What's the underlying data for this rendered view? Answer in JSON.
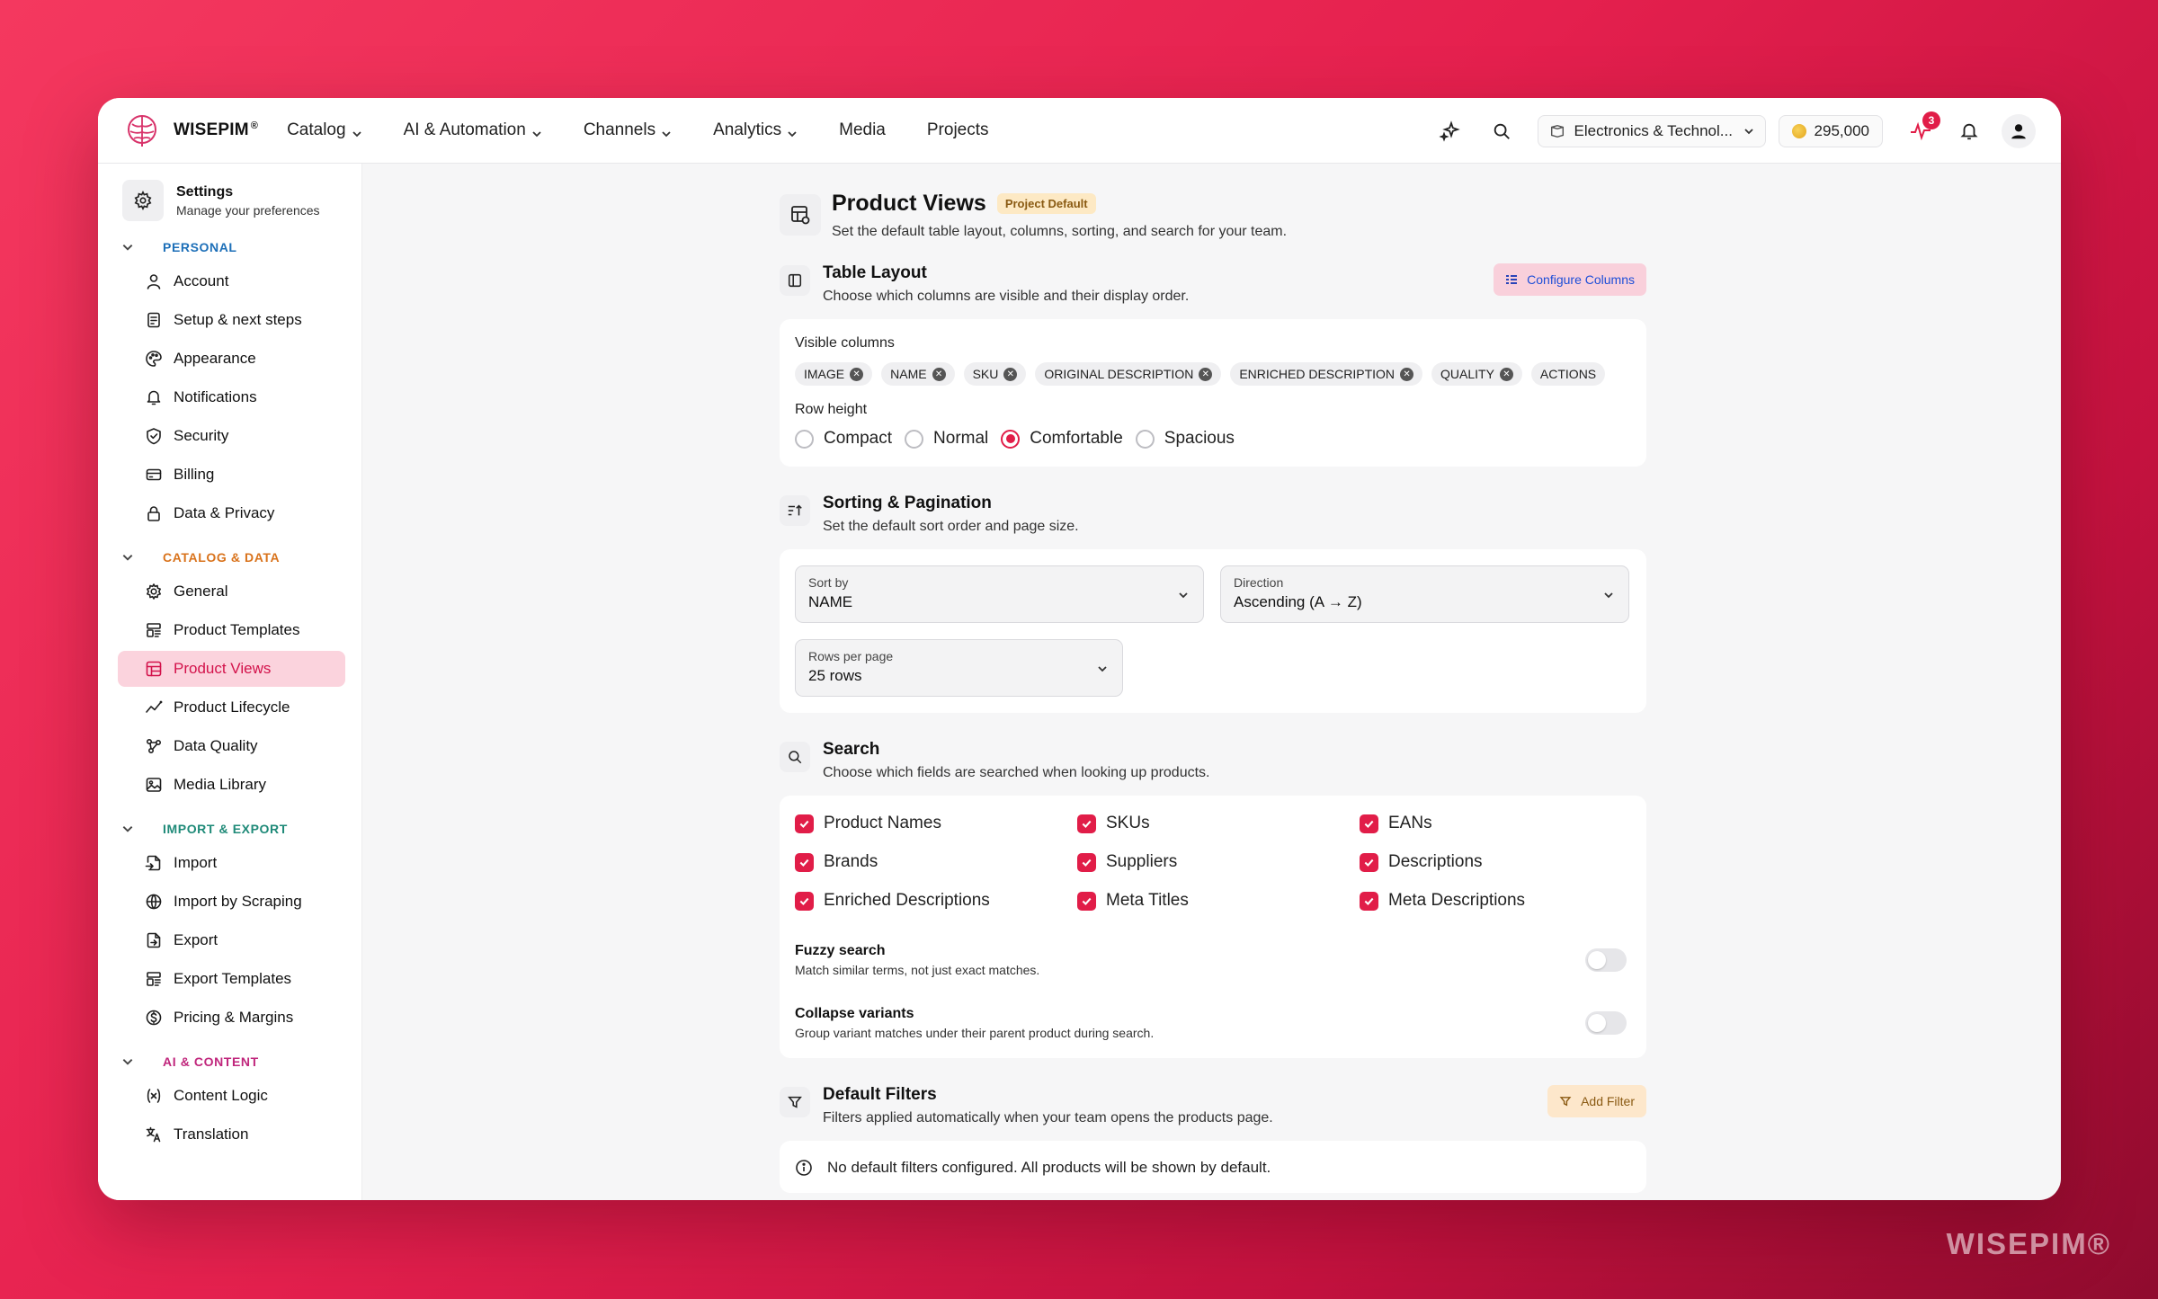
{
  "brand": {
    "name": "WISEPIM",
    "reg": "®"
  },
  "nav": [
    {
      "label": "Catalog",
      "dropdown": true
    },
    {
      "label": "AI & Automation",
      "dropdown": true
    },
    {
      "label": "Channels",
      "dropdown": true
    },
    {
      "label": "Analytics",
      "dropdown": true
    },
    {
      "label": "Media",
      "dropdown": false
    },
    {
      "label": "Projects",
      "dropdown": false
    }
  ],
  "topbar": {
    "workspace": "Electronics & Technol...",
    "credits": "295,000",
    "activity_badge": "3"
  },
  "settings": {
    "title": "Settings",
    "subtitle": "Manage your preferences"
  },
  "sidebar": {
    "personal": {
      "label": "PERSONAL",
      "color": "#1d6fb8",
      "items": [
        "Account",
        "Setup & next steps",
        "Appearance",
        "Notifications",
        "Security",
        "Billing",
        "Data & Privacy"
      ]
    },
    "catalog": {
      "label": "CATALOG & DATA",
      "color": "#d9731c",
      "items": [
        "General",
        "Product Templates",
        "Product Views",
        "Product Lifecycle",
        "Data Quality",
        "Media Library"
      ]
    },
    "import": {
      "label": "IMPORT & EXPORT",
      "color": "#1f8a78",
      "items": [
        "Import",
        "Import by Scraping",
        "Export",
        "Export Templates",
        "Pricing & Margins"
      ]
    },
    "ai": {
      "label": "AI & CONTENT",
      "color": "#c0267c",
      "items": [
        "Content Logic",
        "Translation"
      ]
    },
    "active_item": "Product Views"
  },
  "page": {
    "title": "Product Views",
    "badge": "Project Default",
    "subtitle": "Set the default table layout, columns, sorting, and search for your team."
  },
  "table_layout": {
    "title": "Table Layout",
    "subtitle": "Choose which columns are visible and their display order.",
    "button": "Configure Columns",
    "visible_columns_label": "Visible columns",
    "columns": [
      {
        "label": "IMAGE",
        "removable": true
      },
      {
        "label": "NAME",
        "removable": true
      },
      {
        "label": "SKU",
        "removable": true
      },
      {
        "label": "ORIGINAL DESCRIPTION",
        "removable": true
      },
      {
        "label": "ENRICHED DESCRIPTION",
        "removable": true
      },
      {
        "label": "QUALITY",
        "removable": true
      },
      {
        "label": "ACTIONS",
        "removable": false
      }
    ],
    "row_height_label": "Row height",
    "row_heights": [
      "Compact",
      "Normal",
      "Comfortable",
      "Spacious"
    ],
    "row_height_selected": "Comfortable"
  },
  "sorting": {
    "title": "Sorting & Pagination",
    "subtitle": "Set the default sort order and page size.",
    "sort_by": {
      "label": "Sort by",
      "value": "NAME"
    },
    "direction": {
      "label": "Direction",
      "value": "Ascending (A → Z)"
    },
    "rows_per_page": {
      "label": "Rows per page",
      "value": "25 rows"
    }
  },
  "search": {
    "title": "Search",
    "subtitle": "Choose which fields are searched when looking up products.",
    "fields": [
      {
        "label": "Product Names",
        "checked": true
      },
      {
        "label": "SKUs",
        "checked": true
      },
      {
        "label": "EANs",
        "checked": true
      },
      {
        "label": "Brands",
        "checked": true
      },
      {
        "label": "Suppliers",
        "checked": true
      },
      {
        "label": "Descriptions",
        "checked": true
      },
      {
        "label": "Enriched Descriptions",
        "checked": true
      },
      {
        "label": "Meta Titles",
        "checked": true
      },
      {
        "label": "Meta Descriptions",
        "checked": true
      }
    ],
    "fuzzy": {
      "title": "Fuzzy search",
      "subtitle": "Match similar terms, not just exact matches.",
      "on": false
    },
    "collapse": {
      "title": "Collapse variants",
      "subtitle": "Group variant matches under their parent product during search.",
      "on": false
    }
  },
  "filters": {
    "title": "Default Filters",
    "subtitle": "Filters applied automatically when your team opens the products page.",
    "button": "Add Filter",
    "empty": "No default filters configured. All products will be shown by default."
  },
  "colors": {
    "accent": "#e11d48",
    "active_bg": "#fbd3dd",
    "badge_bg": "#fde9c4"
  },
  "watermark": "WISEPIM®"
}
